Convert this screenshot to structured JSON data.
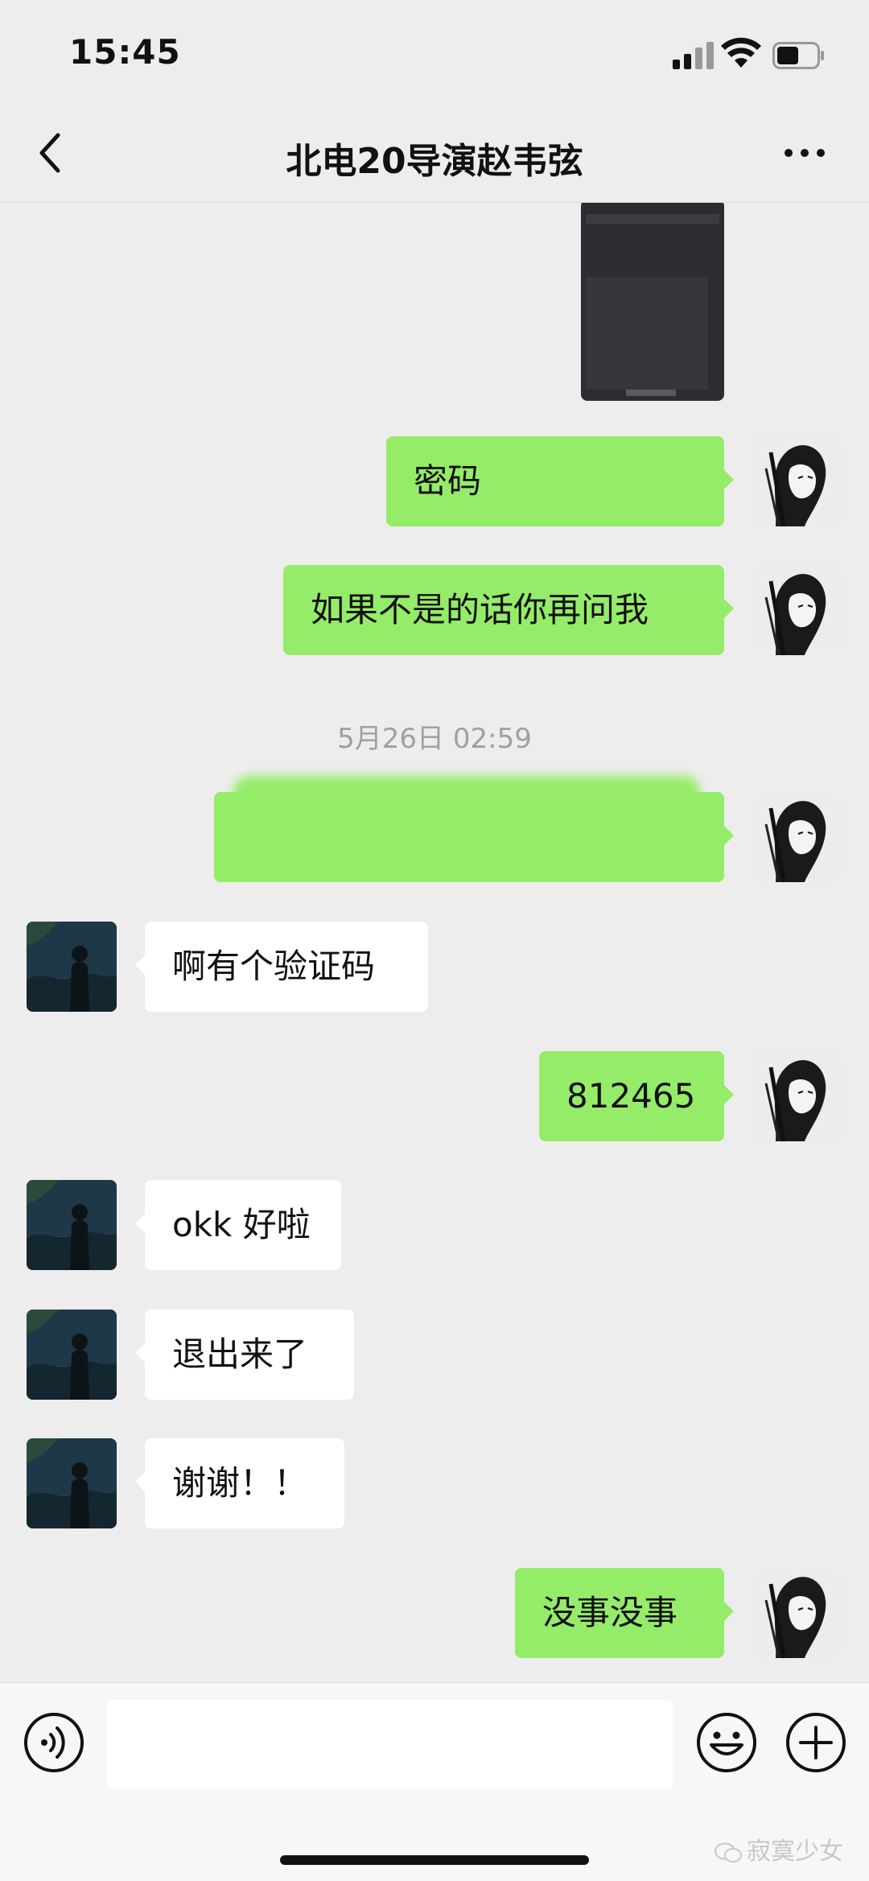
{
  "status_bar": {
    "time": "15:45",
    "signal_icon": "cellular-signal-icon",
    "wifi_icon": "wifi-icon",
    "battery_icon": "battery-icon",
    "battery_level": 0.55
  },
  "nav": {
    "back_icon": "chevron-left-icon",
    "title": "北电20导演赵韦弦",
    "more_icon": "more-dots-icon"
  },
  "colors": {
    "background": "#ededed",
    "outgoing_bubble": "#95ec69",
    "incoming_bubble": "#ffffff",
    "timestamp_text": "#a0a0a0"
  },
  "messages": [
    {
      "direction": "out",
      "type": "image"
    },
    {
      "direction": "out",
      "type": "text",
      "text": "密码"
    },
    {
      "direction": "out",
      "type": "text",
      "text": "如果不是的话你再问我"
    },
    {
      "type": "timestamp",
      "text": "5月26日 02:59"
    },
    {
      "direction": "out",
      "type": "text",
      "text": "",
      "redacted": true
    },
    {
      "direction": "in",
      "type": "text",
      "text": "啊有个验证码"
    },
    {
      "direction": "out",
      "type": "text",
      "text": "812465"
    },
    {
      "direction": "in",
      "type": "text",
      "text": "okk 好啦"
    },
    {
      "direction": "in",
      "type": "text",
      "text": "退出来了"
    },
    {
      "direction": "in",
      "type": "text",
      "text": "谢谢！！"
    },
    {
      "direction": "out",
      "type": "text",
      "text": "没事没事"
    }
  ],
  "input_bar": {
    "voice_icon": "voice-input-icon",
    "input_value": "",
    "emoji_icon": "emoji-icon",
    "plus_icon": "plus-circle-icon"
  },
  "watermark": {
    "icon": "wechat-icon",
    "text": "寂寞少女"
  }
}
